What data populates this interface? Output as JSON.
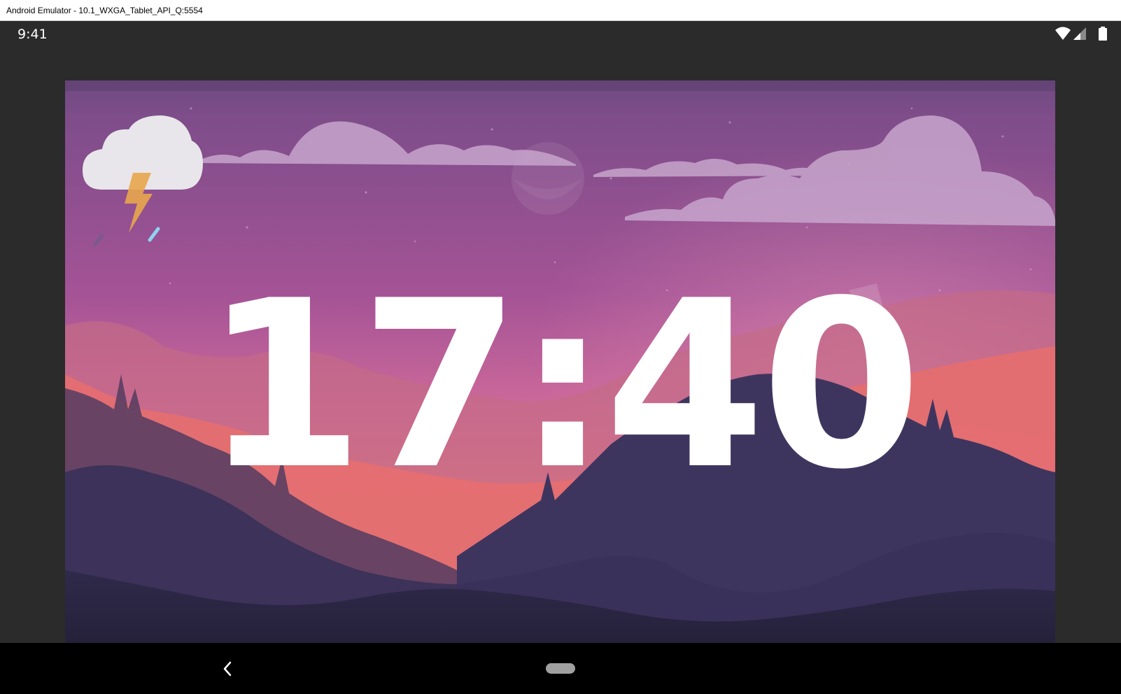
{
  "window": {
    "title": "Android Emulator - 10.1_WXGA_Tablet_API_Q:5554"
  },
  "status_bar": {
    "time": "9:41",
    "icons": [
      "wifi-icon",
      "cellular-signal-icon",
      "battery-icon"
    ]
  },
  "weather": {
    "icon": "thunderstorm-icon"
  },
  "clock": {
    "time": "17:40"
  },
  "nav_bar": {
    "buttons": [
      "back-button",
      "home-button"
    ]
  },
  "colors": {
    "sky_top": "#7e4d8a",
    "sky_mid": "#b95c98",
    "horizon": "#f08078",
    "mountain_dark": "#3b3360",
    "clock_text": "#ffffff"
  }
}
